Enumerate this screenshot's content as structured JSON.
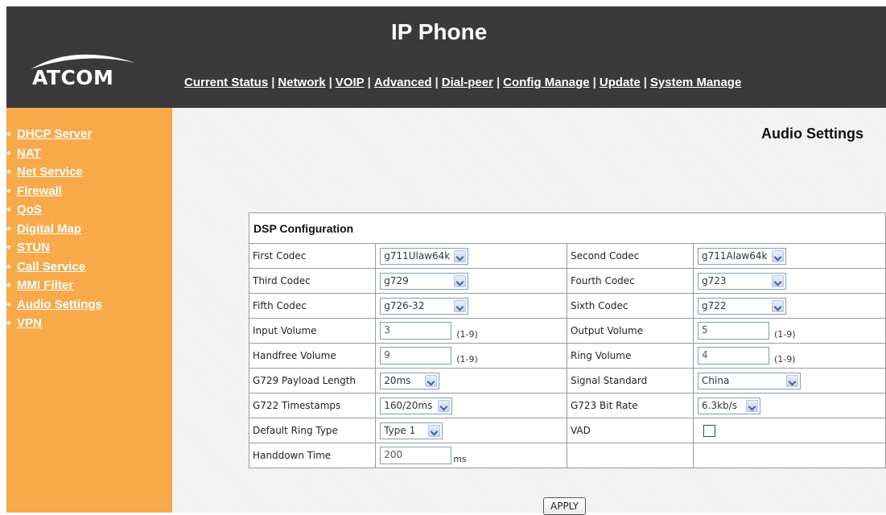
{
  "header": {
    "title": "IP Phone",
    "logo_text": "ATCOM",
    "nav": [
      {
        "label": "Current Status"
      },
      {
        "label": "Network"
      },
      {
        "label": "VOIP"
      },
      {
        "label": "Advanced"
      },
      {
        "label": "Dial-peer"
      },
      {
        "label": "Config Manage"
      },
      {
        "label": "Update"
      },
      {
        "label": "System Manage"
      }
    ]
  },
  "sidebar": {
    "items": [
      {
        "label": "DHCP Server"
      },
      {
        "label": "NAT"
      },
      {
        "label": "Net Service"
      },
      {
        "label": "Firewall"
      },
      {
        "label": "QoS"
      },
      {
        "label": "Digital Map"
      },
      {
        "label": "STUN"
      },
      {
        "label": "Call Service"
      },
      {
        "label": "MMI Filter"
      },
      {
        "label": "Audio Settings"
      },
      {
        "label": "VPN"
      }
    ]
  },
  "main": {
    "page_title": "Audio Settings",
    "section_title": "DSP Configuration",
    "first_codec": {
      "label": "First Codec",
      "value": "g711Ulaw64k"
    },
    "second_codec": {
      "label": "Second Codec",
      "value": "g711Alaw64k"
    },
    "third_codec": {
      "label": "Third Codec",
      "value": "g729"
    },
    "fourth_codec": {
      "label": "Fourth Codec",
      "value": "g723"
    },
    "fifth_codec": {
      "label": "Fifth Codec",
      "value": "g726-32"
    },
    "sixth_codec": {
      "label": "Sixth Codec",
      "value": "g722"
    },
    "input_volume": {
      "label": "Input Volume",
      "value": "3",
      "hint": "(1-9)"
    },
    "output_volume": {
      "label": "Output Volume",
      "value": "5",
      "hint": "(1-9)"
    },
    "handfree_volume": {
      "label": "Handfree Volume",
      "value": "9",
      "hint": "(1-9)"
    },
    "ring_volume": {
      "label": "Ring Volume",
      "value": "4",
      "hint": "(1-9)"
    },
    "g729_payload": {
      "label": "G729 Payload Length",
      "value": "20ms"
    },
    "signal_standard": {
      "label": "Signal Standard",
      "value": "China"
    },
    "g722_timestamps": {
      "label": "G722 Timestamps",
      "value": "160/20ms"
    },
    "g723_bitrate": {
      "label": "G723 Bit Rate",
      "value": "6.3kb/s"
    },
    "default_ring": {
      "label": "Default Ring Type",
      "value": "Type 1"
    },
    "vad": {
      "label": "VAD",
      "checked": false
    },
    "handdown_time": {
      "label": "Handdown Time",
      "value": "200",
      "unit": "ms"
    },
    "apply_label": "APPLY"
  }
}
